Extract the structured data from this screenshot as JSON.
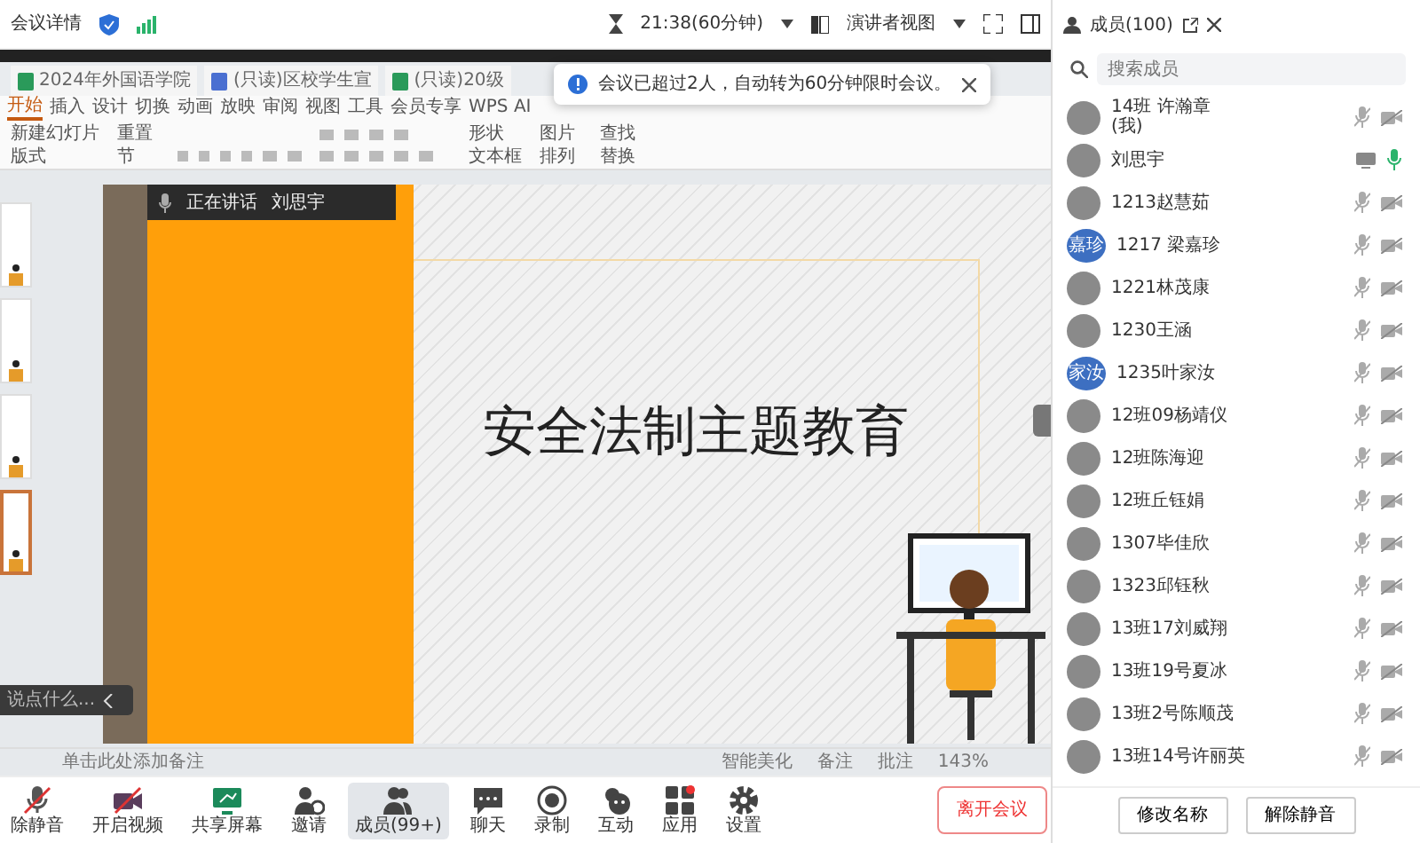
{
  "top_bar": {
    "title": "会议详情",
    "timer": "21:38(60分钟)",
    "view_menu": "演讲者视图"
  },
  "toast": {
    "message": "会议已超过2人，自动转为60分钟限时会议。"
  },
  "presentation": {
    "doc_tabs": [
      {
        "label": "2024年外国语学院"
      },
      {
        "label": "(只读)区校学生宣"
      },
      {
        "label": "(只读)20级"
      }
    ],
    "ribbon_tabs": [
      {
        "label": "开始",
        "selected": true
      },
      {
        "label": "插入",
        "selected": false
      },
      {
        "label": "设计",
        "selected": false
      },
      {
        "label": "切换",
        "selected": false
      },
      {
        "label": "动画",
        "selected": false
      },
      {
        "label": "放映",
        "selected": false
      },
      {
        "label": "审阅",
        "selected": false
      },
      {
        "label": "视图",
        "selected": false
      },
      {
        "label": "工具",
        "selected": false
      },
      {
        "label": "会员专享",
        "selected": false
      },
      {
        "label": "WPS AI",
        "selected": false
      }
    ],
    "ribbon_groups": [
      [
        "新建幻灯片",
        "版式",
        "重置",
        "节"
      ],
      [
        "形状",
        "文本框",
        "图片",
        "排列"
      ],
      [
        "查找",
        "替换"
      ]
    ],
    "thumbnails": [
      {
        "selected": false
      },
      {
        "selected": false
      },
      {
        "selected": false
      },
      {
        "selected": true
      }
    ],
    "speaker_banner": {
      "label": "正在讲话",
      "name": "刘思宇"
    },
    "slide_title": "安全法制主题教育",
    "chat_placeholder": "说点什么...",
    "notes_placeholder": "单击此处添加备注",
    "status_items": [
      "智能美化",
      "备注",
      "批注"
    ],
    "zoom": "143%"
  },
  "toolbar": {
    "items": [
      {
        "kind": "mic",
        "label": "除静音",
        "selected": false
      },
      {
        "kind": "camera",
        "label": "开启视频",
        "selected": false
      },
      {
        "kind": "share",
        "label": "共享屏幕",
        "selected": false
      },
      {
        "kind": "invite",
        "label": "邀请",
        "selected": false
      },
      {
        "kind": "members",
        "label": "成员(99+)",
        "selected": true
      },
      {
        "kind": "chat",
        "label": "聊天",
        "selected": false
      },
      {
        "kind": "record",
        "label": "录制",
        "selected": false
      },
      {
        "kind": "emoji",
        "label": "互动",
        "selected": false
      },
      {
        "kind": "apps",
        "label": "应用",
        "selected": false
      },
      {
        "kind": "settings",
        "label": "设置",
        "selected": false
      }
    ],
    "leave_button": "离开会议"
  },
  "members_panel": {
    "title": "成员(100)",
    "search_placeholder": "搜索成员",
    "members": [
      {
        "name": "14班 许瀚章",
        "note": "(我)",
        "mic_on": false,
        "sharing": false
      },
      {
        "name": "刘思宇",
        "mic_on": true,
        "sharing": true
      },
      {
        "name": "1213赵慧茹",
        "mic_on": false,
        "sharing": false
      },
      {
        "name": "1217 梁嘉珍",
        "avatar_text": "嘉珍",
        "mic_on": false,
        "sharing": false
      },
      {
        "name": "1221林茂康",
        "mic_on": false,
        "sharing": false
      },
      {
        "name": "1230王涵",
        "mic_on": false,
        "sharing": false
      },
      {
        "name": "1235叶家汝",
        "avatar_text": "家汝",
        "mic_on": false,
        "sharing": false
      },
      {
        "name": "12班09杨靖仪",
        "mic_on": false,
        "sharing": false
      },
      {
        "name": "12班陈海迎",
        "mic_on": false,
        "sharing": false
      },
      {
        "name": "12班丘钰娟",
        "mic_on": false,
        "sharing": false
      },
      {
        "name": "1307毕佳欣",
        "mic_on": false,
        "sharing": false
      },
      {
        "name": "1323邱钰秋",
        "mic_on": false,
        "sharing": false
      },
      {
        "name": "13班17刘威翔",
        "mic_on": false,
        "sharing": false
      },
      {
        "name": "13班19号夏冰",
        "mic_on": false,
        "sharing": false
      },
      {
        "name": "13班2号陈顺茂",
        "mic_on": false,
        "sharing": false
      },
      {
        "name": "13班14号许丽英",
        "mic_on": false,
        "sharing": false
      }
    ],
    "buttons": [
      "修改名称",
      "解除静音"
    ]
  }
}
